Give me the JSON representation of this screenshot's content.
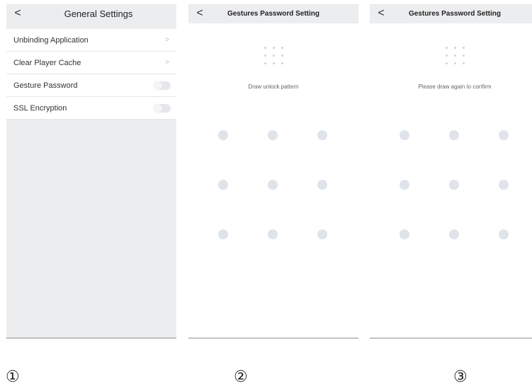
{
  "screens": [
    {
      "title": "General Settings",
      "back_icon": "chevron-left-icon",
      "items": [
        {
          "label": "Unbinding Application",
          "accessory": "chevron-right-icon"
        },
        {
          "label": "Clear Player Cache",
          "accessory": "chevron-right-icon"
        },
        {
          "label": "Gesture Password",
          "accessory": "toggle",
          "toggle_on": false
        },
        {
          "label": "SSL Encryption",
          "accessory": "toggle",
          "toggle_on": false
        }
      ],
      "marker": "①"
    },
    {
      "title": "Gestures Password Setting",
      "back_icon": "chevron-left-icon",
      "prompt": "Draw unlock pattern",
      "marker": "②"
    },
    {
      "title": "Gestures Password Setting",
      "back_icon": "chevron-left-icon",
      "prompt": "Please draw again to confirm",
      "marker": "③"
    }
  ],
  "glyphs": {
    "back": "<",
    "chevron": ">"
  },
  "colors": {
    "panel_bg": "#ecedef",
    "dot": "#dfe3ea",
    "mini_dot": "#cfd3da"
  }
}
